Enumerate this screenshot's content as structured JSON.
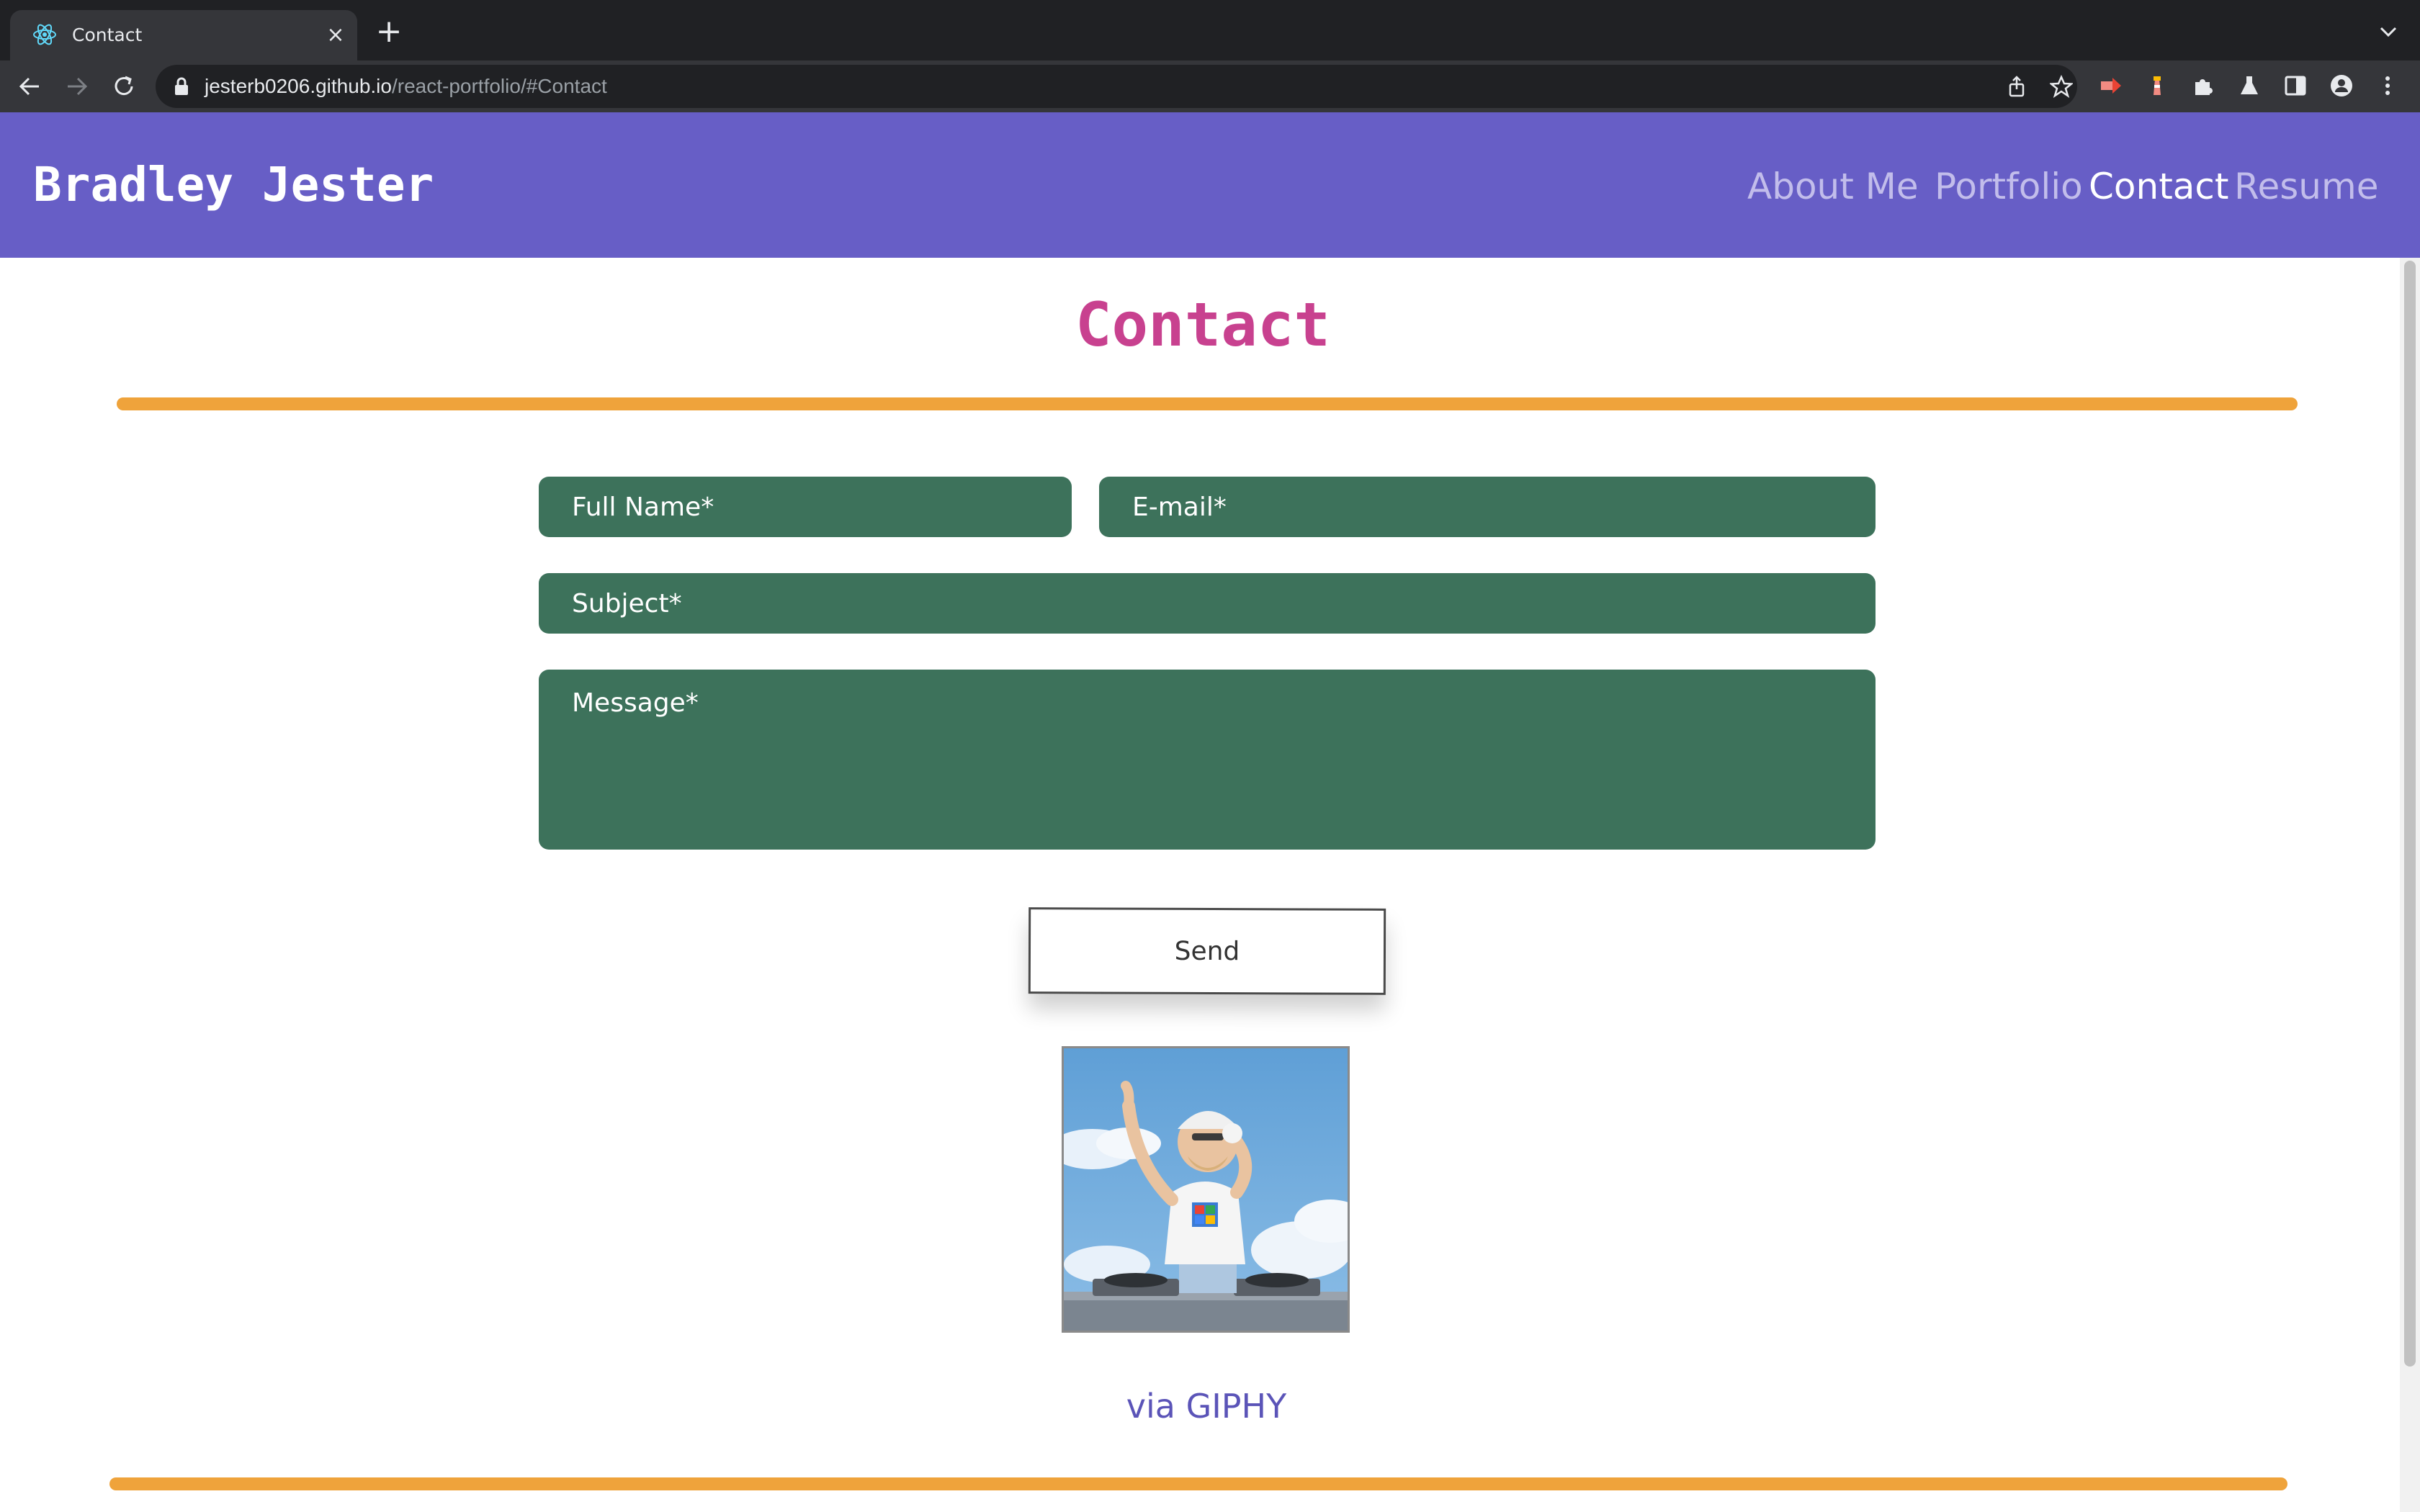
{
  "browser": {
    "tab_title": "Contact",
    "url_host": "jesterb0206.github.io",
    "url_path": "/react-portfolio/#Contact"
  },
  "header": {
    "brand": "Bradley Jester",
    "nav": [
      {
        "label": "About Me",
        "active": false
      },
      {
        "label": "Portfolio",
        "active": false
      },
      {
        "label": "Contact",
        "active": true
      },
      {
        "label": "Resume",
        "active": false
      }
    ]
  },
  "contact": {
    "heading": "Contact",
    "full_name_placeholder": "Full Name*",
    "email_placeholder": "E-mail*",
    "subject_placeholder": "Subject*",
    "message_placeholder": "Message*",
    "send_label": "Send",
    "giphy_credit": "via GIPHY"
  },
  "colors": {
    "header_bg": "#675ec6",
    "heading": "#c8418f",
    "rule": "#efa33b",
    "field_bg": "#3d725b",
    "link": "#5b54b8"
  }
}
